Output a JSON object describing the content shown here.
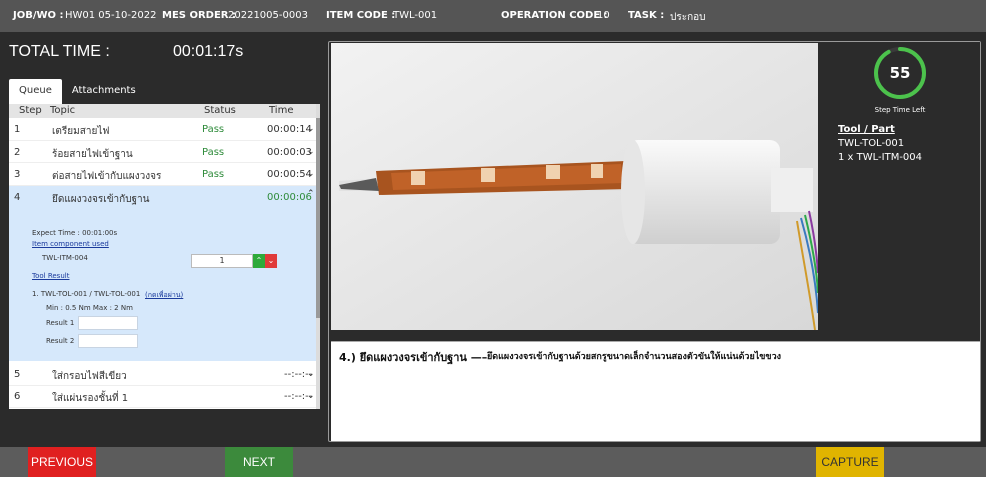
{
  "header": {
    "job_label": "JOB/WO :",
    "job_value": "HW01 05-10-2022",
    "mes_label": "MES ORDER :",
    "mes_value": "20221005-0003",
    "item_label": "ITEM CODE :",
    "item_value": "TWL-001",
    "op_label": "OPERATION CODE :",
    "op_value": "10",
    "task_label": "TASK :",
    "task_value": "ประกอบ"
  },
  "total_time": {
    "label": "TOTAL TIME :",
    "value": "00:01:17s"
  },
  "tabs": [
    {
      "label": "Queue",
      "active": true
    },
    {
      "label": "Attachments",
      "active": false
    }
  ],
  "queue": {
    "columns": {
      "step": "Step",
      "topic": "Topic",
      "status": "Status",
      "time": "Time"
    },
    "rows": [
      {
        "step": "1",
        "topic": "เตรียมสายไฟ",
        "status": "Pass",
        "time": "00:00:14"
      },
      {
        "step": "2",
        "topic": "ร้อยสายไฟเข้าฐาน",
        "status": "Pass",
        "time": "00:00:03"
      },
      {
        "step": "3",
        "topic": "ต่อสายไฟเข้ากับแผงวงจร",
        "status": "Pass",
        "time": "00:00:54"
      },
      {
        "step": "4",
        "topic": "ยึดแผงวงจรเข้ากับฐาน",
        "status": "",
        "time": "00:00:06"
      },
      {
        "step": "5",
        "topic": "ใส่กรอบไฟสีเขียว",
        "status": "",
        "time": "--:--:--"
      },
      {
        "step": "6",
        "topic": "ใส่แผ่นรองชั้นที่ 1",
        "status": "",
        "time": "--:--:--"
      }
    ],
    "expanded": {
      "expect_time": "Expect Time :    00:01:00s",
      "item_component_link": "Item component used",
      "component_code": "TWL-ITM-004",
      "quantity": "1",
      "tool_result_link": "Tool Result",
      "tool_line": "1. TWL-TOL-001 / TWL-TOL-001",
      "tool_action": "(กดเพื่อผ่าน)",
      "torque": "Min : 0.5 Nm   Max : 2 Nm",
      "result1": "Result 1",
      "result2": "Result 2"
    }
  },
  "timer": {
    "value": "55",
    "label": "Step Time Left",
    "progress": 0.92
  },
  "tool_part": {
    "title": "Tool / Part",
    "items": [
      "TWL-TOL-001",
      "1 x TWL-ITM-004"
    ]
  },
  "instruction": {
    "title": "4.) ยึดแผงวงจรเข้ากับฐาน —–",
    "text": "ยึดแผงวงจรเข้ากับฐานด้วยสกรูขนาดเล็กจำนวนสองตัวขันให้แน่นด้วยไขขวง"
  },
  "footer": {
    "previous": "PREVIOUS",
    "next": "NEXT",
    "capture": "CAPTURE"
  },
  "colors": {
    "pass": "#2e8b3a",
    "timer_ring": "#4cc24c",
    "previous": "#e02020",
    "next": "#3c8a3c",
    "capture": "#e0b400"
  }
}
